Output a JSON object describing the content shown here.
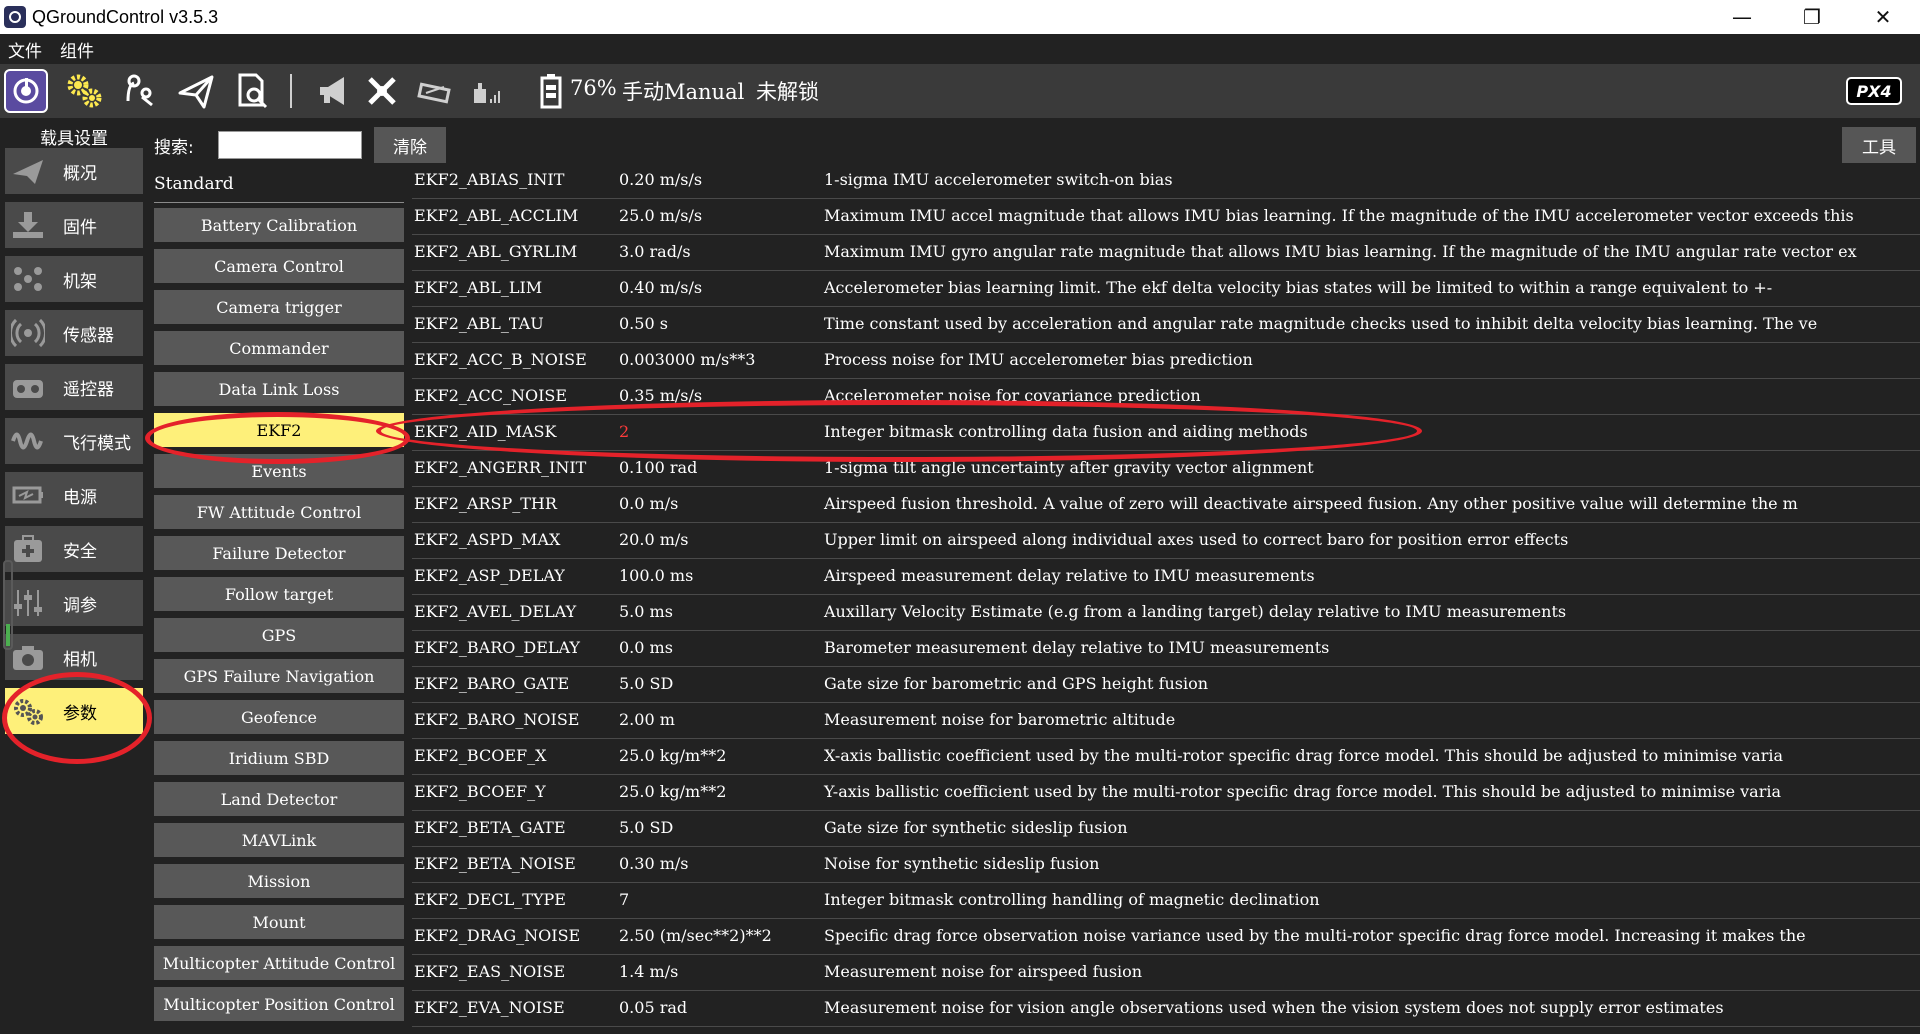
{
  "window": {
    "title": "QGroundControl v3.5.3"
  },
  "menu": [
    "文件",
    "组件"
  ],
  "toolbar": {
    "battery": "76%",
    "flight_mode": "手动Manual",
    "arm_status": "未解锁",
    "logo": "PX4"
  },
  "sidebar": {
    "title": "载具设置",
    "items": [
      {
        "label": "概况",
        "icon": "paper-plane-icon"
      },
      {
        "label": "固件",
        "icon": "download-icon"
      },
      {
        "label": "机架",
        "icon": "frame-icon"
      },
      {
        "label": "传感器",
        "icon": "sensor-icon"
      },
      {
        "label": "遥控器",
        "icon": "radio-icon"
      },
      {
        "label": "飞行模式",
        "icon": "wave-icon"
      },
      {
        "label": "电源",
        "icon": "power-icon"
      },
      {
        "label": "安全",
        "icon": "plus-icon"
      },
      {
        "label": "调参",
        "icon": "sliders-icon"
      },
      {
        "label": "相机",
        "icon": "camera-icon"
      },
      {
        "label": "参数",
        "icon": "gears-icon"
      }
    ]
  },
  "search": {
    "label": "搜索:",
    "value": "",
    "clear_label": "清除",
    "tools_label": "工具"
  },
  "groups": {
    "header": "Standard",
    "items": [
      "Battery Calibration",
      "Camera Control",
      "Camera trigger",
      "Commander",
      "Data Link Loss",
      "EKF2",
      "Events",
      "FW Attitude Control",
      "Failure Detector",
      "Follow target",
      "GPS",
      "GPS Failure Navigation",
      "Geofence",
      "Iridium SBD",
      "Land Detector",
      "MAVLink",
      "Mission",
      "Mount",
      "Multicopter Attitude Control",
      "Multicopter Position Control"
    ],
    "selected": "EKF2"
  },
  "params": [
    {
      "name": "EKF2_ABIAS_INIT",
      "value": "0.20 m/s/s",
      "desc": "1-sigma IMU accelerometer switch-on bias"
    },
    {
      "name": "EKF2_ABL_ACCLIM",
      "value": "25.0 m/s/s",
      "desc": "Maximum IMU accel magnitude that allows IMU bias learning. If the magnitude of the IMU accelerometer vector exceeds this"
    },
    {
      "name": "EKF2_ABL_GYRLIM",
      "value": "3.0 rad/s",
      "desc": "Maximum IMU gyro angular rate magnitude that allows IMU bias learning. If the magnitude of the IMU angular rate vector ex"
    },
    {
      "name": "EKF2_ABL_LIM",
      "value": "0.40 m/s/s",
      "desc": "Accelerometer bias learning limit. The ekf delta velocity bias states will be limited to within a range equivalent to +-"
    },
    {
      "name": "EKF2_ABL_TAU",
      "value": "0.50 s",
      "desc": "Time constant used by acceleration and angular rate magnitude checks used to inhibit delta velocity bias learning. The ve"
    },
    {
      "name": "EKF2_ACC_B_NOISE",
      "value": "0.003000 m/s**3",
      "desc": "Process noise for IMU accelerometer bias prediction"
    },
    {
      "name": "EKF2_ACC_NOISE",
      "value": "0.35 m/s/s",
      "desc": "Accelerometer noise for covariance prediction"
    },
    {
      "name": "EKF2_AID_MASK",
      "value": "2",
      "desc": "Integer bitmask controlling data fusion and aiding methods",
      "changed": true
    },
    {
      "name": "EKF2_ANGERR_INIT",
      "value": "0.100 rad",
      "desc": "1-sigma tilt angle uncertainty after gravity vector alignment"
    },
    {
      "name": "EKF2_ARSP_THR",
      "value": "0.0 m/s",
      "desc": "Airspeed fusion threshold. A value of zero will deactivate airspeed fusion. Any other positive value will determine the m"
    },
    {
      "name": "EKF2_ASPD_MAX",
      "value": "20.0 m/s",
      "desc": "Upper limit on airspeed along individual axes used to correct baro for position error effects"
    },
    {
      "name": "EKF2_ASP_DELAY",
      "value": "100.0 ms",
      "desc": "Airspeed measurement delay relative to IMU measurements"
    },
    {
      "name": "EKF2_AVEL_DELAY",
      "value": "5.0 ms",
      "desc": "Auxillary Velocity Estimate (e.g from a landing target) delay relative to IMU measurements"
    },
    {
      "name": "EKF2_BARO_DELAY",
      "value": "0.0 ms",
      "desc": "Barometer measurement delay relative to IMU measurements"
    },
    {
      "name": "EKF2_BARO_GATE",
      "value": "5.0 SD",
      "desc": "Gate size for barometric and GPS height fusion"
    },
    {
      "name": "EKF2_BARO_NOISE",
      "value": "2.00 m",
      "desc": "Measurement noise for barometric altitude"
    },
    {
      "name": "EKF2_BCOEF_X",
      "value": "25.0 kg/m**2",
      "desc": "X-axis ballistic coefficient used by the multi-rotor specific drag force model. This should be adjusted to minimise varia"
    },
    {
      "name": "EKF2_BCOEF_Y",
      "value": "25.0 kg/m**2",
      "desc": "Y-axis ballistic coefficient used by the multi-rotor specific drag force model. This should be adjusted to minimise varia"
    },
    {
      "name": "EKF2_BETA_GATE",
      "value": "5.0 SD",
      "desc": "Gate size for synthetic sideslip fusion"
    },
    {
      "name": "EKF2_BETA_NOISE",
      "value": "0.30 m/s",
      "desc": "Noise for synthetic sideslip fusion"
    },
    {
      "name": "EKF2_DECL_TYPE",
      "value": "7",
      "desc": "Integer bitmask controlling handling of magnetic declination"
    },
    {
      "name": "EKF2_DRAG_NOISE",
      "value": "2.50 (m/sec**2)**2",
      "desc": "Specific drag force observation noise variance used by the multi-rotor specific drag force model. Increasing it makes the"
    },
    {
      "name": "EKF2_EAS_NOISE",
      "value": "1.4 m/s",
      "desc": "Measurement noise for airspeed fusion"
    },
    {
      "name": "EKF2_EVA_NOISE",
      "value": "0.05 rad",
      "desc": "Measurement noise for vision angle observations used when the vision system does not supply error estimates"
    }
  ],
  "colors": {
    "highlight": "#fef07a",
    "annotation": "#e4222a",
    "changed_value": "#ff3b3b",
    "toolbar_bg": "#3a3a3a",
    "button_bg": "#585858"
  }
}
